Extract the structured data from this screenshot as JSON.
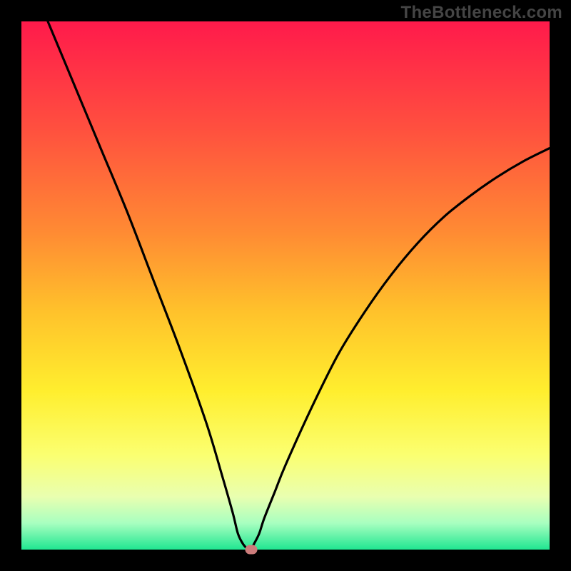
{
  "watermark": "TheBottleneck.com",
  "chart_data": {
    "type": "line",
    "title": "",
    "xlabel": "",
    "ylabel": "",
    "x_range": [
      0,
      100
    ],
    "y_range": [
      0,
      100
    ],
    "legend": false,
    "grid": false,
    "background_gradient_stops": [
      {
        "pos": 0.0,
        "color": "#ff1a4b"
      },
      {
        "pos": 0.2,
        "color": "#ff4f3f"
      },
      {
        "pos": 0.4,
        "color": "#ff8b33"
      },
      {
        "pos": 0.55,
        "color": "#ffc22b"
      },
      {
        "pos": 0.7,
        "color": "#ffee2e"
      },
      {
        "pos": 0.82,
        "color": "#fbff70"
      },
      {
        "pos": 0.9,
        "color": "#e9ffb0"
      },
      {
        "pos": 0.95,
        "color": "#a8ffc0"
      },
      {
        "pos": 1.0,
        "color": "#20e691"
      }
    ],
    "series": [
      {
        "name": "bottleneck-curve",
        "x": [
          5,
          10,
          15,
          20,
          25,
          30,
          35,
          38,
          40,
          41,
          42,
          43,
          43.5,
          44,
          45,
          46,
          48,
          50,
          55,
          60,
          65,
          70,
          75,
          80,
          85,
          90,
          95,
          100
        ],
        "y": [
          100,
          88,
          76,
          64,
          51,
          38,
          24,
          14,
          7,
          3,
          1,
          0,
          0,
          1,
          3,
          6,
          11,
          16,
          27,
          37,
          45,
          52,
          58,
          63,
          67,
          70.5,
          73.5,
          76
        ]
      }
    ],
    "marker": {
      "x": 43.5,
      "y": 0,
      "color": "#cc7c7b"
    }
  }
}
